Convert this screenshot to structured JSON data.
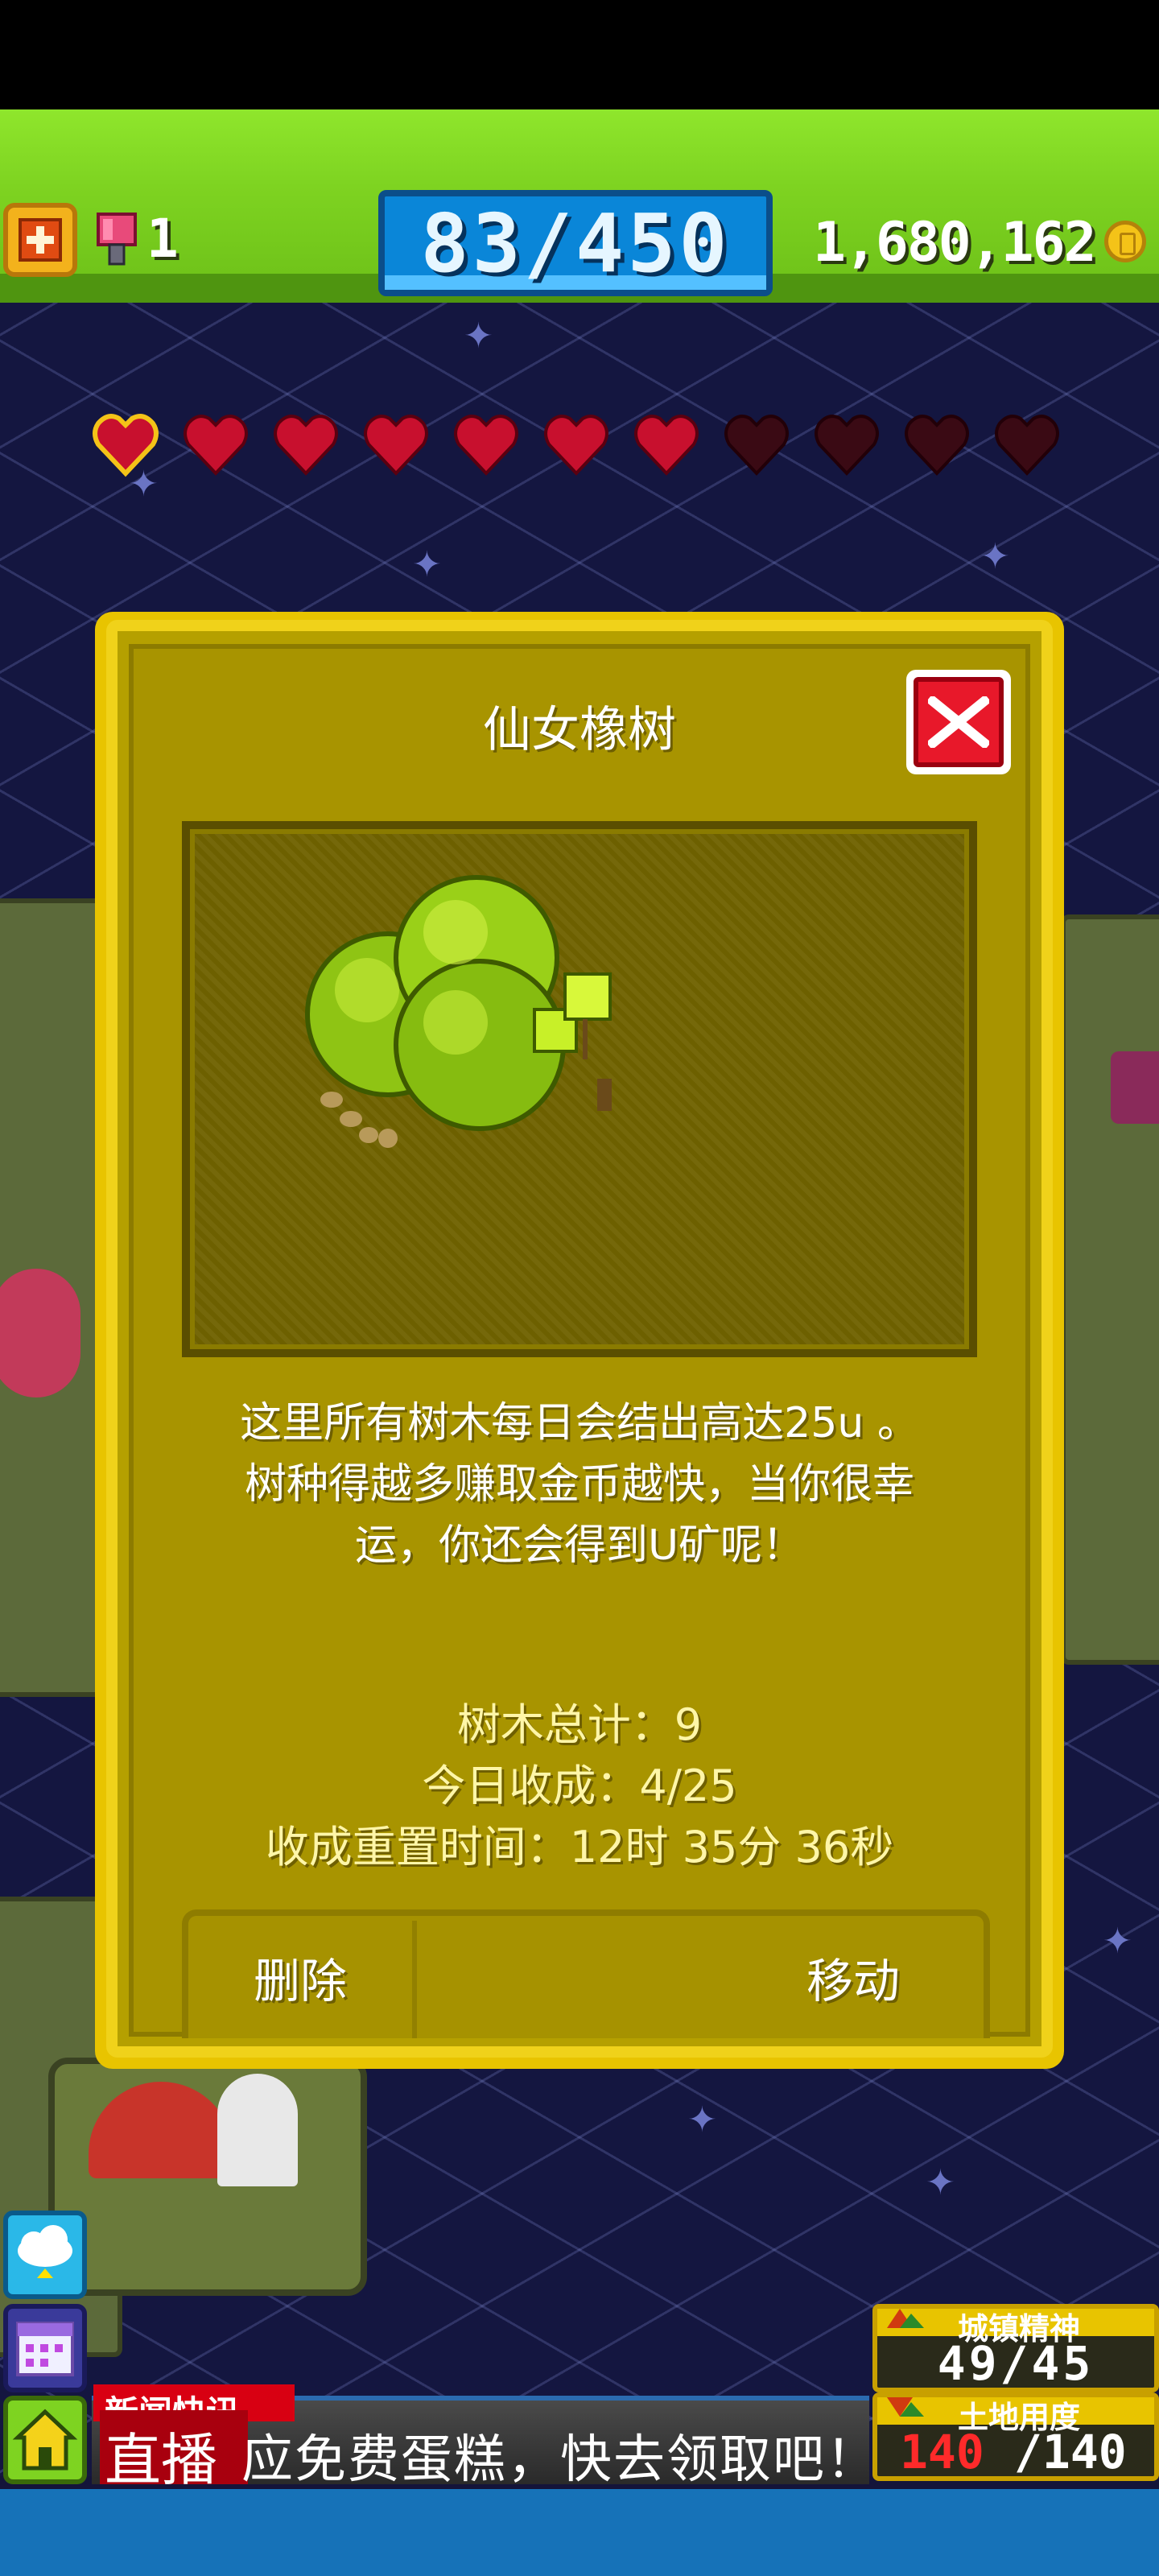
{
  "hud": {
    "tickets": "1",
    "population": "83/450",
    "coins": "1,680,162"
  },
  "hearts": {
    "filled": 7,
    "total": 11
  },
  "dialog": {
    "title": "仙女橡树",
    "description_lines": [
      "这里所有树木每日会结出高达25u 。",
      "树种得越多赚取金币越快，当你很幸",
      "运，你还会得到U矿呢！"
    ],
    "tree_total": "树木总计：9",
    "harvest_today": "今日收成：4/25",
    "reset_time": "收成重置时间：12时 35分 36秒",
    "delete_label": "删除",
    "move_label": "移动"
  },
  "news": {
    "tag": "新闻快讯",
    "live": "直播",
    "text": "应免费蛋糕，快去领取吧！"
  },
  "panels": {
    "happiness_label": "城镇精神",
    "happiness_value": "49/45",
    "land_label": "土地用度",
    "land_used": "140",
    "land_total": "/140"
  },
  "colors": {
    "hud_green": "#7ed321",
    "dialog_gold": "#b5a000",
    "heart_red": "#c8102e",
    "heart_empty": "#3a0a14"
  }
}
